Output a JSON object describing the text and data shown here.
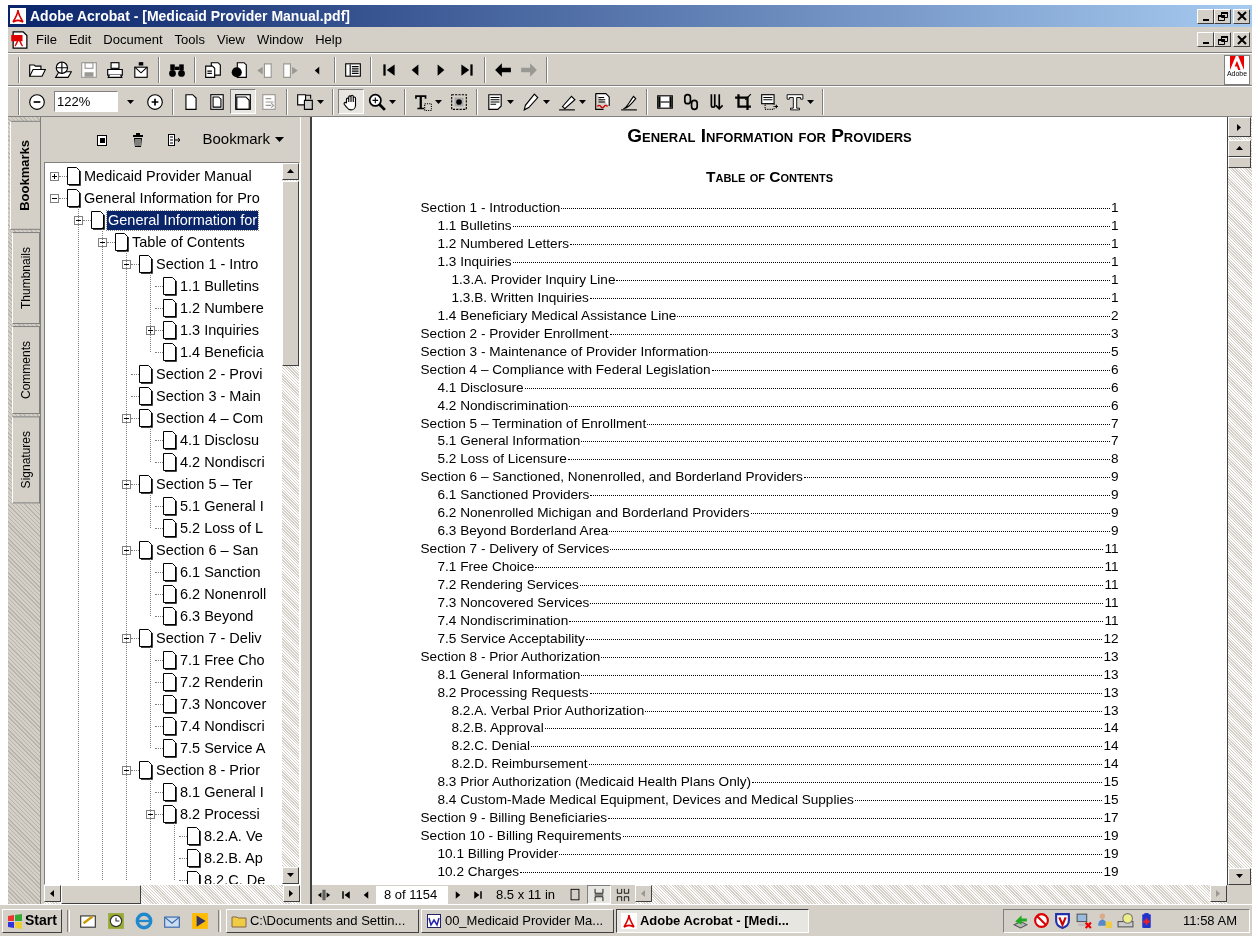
{
  "window": {
    "title": "Adobe Acrobat - [Medicaid Provider Manual.pdf]"
  },
  "menu": [
    "File",
    "Edit",
    "Document",
    "Tools",
    "View",
    "Window",
    "Help"
  ],
  "toolbar_1": [
    {
      "disabled": false
    },
    {
      "disabled": false
    },
    {
      "disabled": true
    },
    {
      "disabled": false
    },
    {
      "disabled": false
    },
    {
      "disabled": false
    },
    {
      "disabled": false
    },
    {
      "disabled": false
    },
    {
      "disabled": true
    },
    {
      "disabled": true
    },
    {
      "disabled": false
    },
    {
      "disabled": false
    },
    {
      "disabled": false
    },
    {
      "disabled": false
    },
    {
      "disabled": false
    },
    {
      "disabled": false
    },
    {
      "disabled": false
    },
    {
      "disabled": true
    }
  ],
  "brand": {
    "label": "Adobe"
  },
  "zoom": {
    "value": "122%"
  },
  "toolbar_2": [
    {
      "disabled": false,
      "selected": false
    },
    {
      "disabled": false,
      "selected": false
    },
    {
      "disabled": false,
      "selected": false
    },
    {
      "disabled": false,
      "selected": false
    },
    {
      "disabled": false,
      "selected": true
    },
    {
      "disabled": true,
      "selected": false
    },
    {
      "disabled": false,
      "selected": false
    },
    {
      "disabled": false,
      "selected": true
    },
    {
      "disabled": false,
      "selected": false
    },
    {
      "disabled": false,
      "selected": false
    },
    {
      "disabled": false,
      "selected": false
    },
    {
      "disabled": false,
      "selected": false
    },
    {
      "disabled": false,
      "selected": false
    },
    {
      "disabled": false,
      "selected": false
    },
    {
      "disabled": false,
      "selected": false
    },
    {
      "disabled": false,
      "selected": false
    },
    {
      "disabled": false,
      "selected": false
    },
    {
      "disabled": false,
      "selected": false
    },
    {
      "disabled": false,
      "selected": false
    },
    {
      "disabled": false,
      "selected": false
    },
    {
      "disabled": false,
      "selected": false
    },
    {
      "disabled": false,
      "selected": false
    }
  ],
  "panel_tabs": [
    {
      "label": "Bookmarks",
      "selected": true
    },
    {
      "label": "Thumbnails",
      "selected": false
    },
    {
      "label": "Comments",
      "selected": false
    },
    {
      "label": "Signatures",
      "selected": false
    }
  ],
  "bookmark_panel": {
    "menu_label": "Bookmark"
  },
  "bookmarks": [
    {
      "label": "Medicaid Provider Manual",
      "selected": false,
      "expanded": false
    },
    {
      "label": "General Information for Pro",
      "selected": false,
      "expanded": true,
      "children": [
        {
          "label": "General Information for",
          "selected": true,
          "expanded": true,
          "children": [
            {
              "label": "Table of Contents",
              "selected": false,
              "expanded": true,
              "children": [
                {
                  "label": "Section 1 - Intro",
                  "selected": false,
                  "expanded": true,
                  "children": [
                    {
                      "label": "1.1 Bulletins",
                      "selected": false
                    },
                    {
                      "label": "1.2 Numbere",
                      "selected": false
                    },
                    {
                      "label": "1.3 Inquiries",
                      "selected": false,
                      "expanded": false
                    },
                    {
                      "label": "1.4 Beneficia",
                      "selected": false
                    }
                  ]
                },
                {
                  "label": "Section 2 - Provi",
                  "selected": false
                },
                {
                  "label": "Section 3 - Main",
                  "selected": false
                },
                {
                  "label": "Section 4 – Com",
                  "selected": false,
                  "expanded": true,
                  "children": [
                    {
                      "label": "4.1 Disclosu",
                      "selected": false
                    },
                    {
                      "label": "4.2 Nondiscri",
                      "selected": false
                    }
                  ]
                },
                {
                  "label": "Section 5 – Ter",
                  "selected": false,
                  "expanded": true,
                  "children": [
                    {
                      "label": "5.1 General I",
                      "selected": false
                    },
                    {
                      "label": "5.2 Loss of L",
                      "selected": false
                    }
                  ]
                },
                {
                  "label": "Section 6 – San",
                  "selected": false,
                  "expanded": true,
                  "children": [
                    {
                      "label": "6.1 Sanction",
                      "selected": false
                    },
                    {
                      "label": "6.2 Nonenroll",
                      "selected": false
                    },
                    {
                      "label": "6.3 Beyond",
                      "selected": false
                    }
                  ]
                },
                {
                  "label": "Section 7 - Deliv",
                  "selected": false,
                  "expanded": true,
                  "children": [
                    {
                      "label": "7.1 Free Cho",
                      "selected": false
                    },
                    {
                      "label": "7.2 Renderin",
                      "selected": false
                    },
                    {
                      "label": "7.3 Noncover",
                      "selected": false
                    },
                    {
                      "label": "7.4 Nondiscri",
                      "selected": false
                    },
                    {
                      "label": "7.5 Service A",
                      "selected": false
                    }
                  ]
                },
                {
                  "label": "Section 8 - Prior",
                  "selected": false,
                  "expanded": true,
                  "children": [
                    {
                      "label": "8.1 General I",
                      "selected": false
                    },
                    {
                      "label": "8.2 Processi",
                      "selected": false,
                      "expanded": true,
                      "children": [
                        {
                          "label": "8.2.A. Ve",
                          "selected": false
                        },
                        {
                          "label": "8.2.B. Ap",
                          "selected": false
                        },
                        {
                          "label": "8.2.C. De",
                          "selected": false
                        }
                      ]
                    }
                  ]
                }
              ]
            }
          ]
        }
      ]
    }
  ],
  "document": {
    "title": "General Information for Providers",
    "subtitle": "Table of Contents",
    "toc": [
      {
        "title": "Section 1 - Introduction",
        "page": "1",
        "children": [
          {
            "title": "1.1 Bulletins",
            "page": "1"
          },
          {
            "title": "1.2 Numbered Letters",
            "page": "1"
          },
          {
            "title": "1.3 Inquiries",
            "page": "1",
            "children": [
              {
                "title": "1.3.A. Provider Inquiry Line",
                "page": "1"
              },
              {
                "title": "1.3.B. Written Inquiries",
                "page": "1"
              }
            ]
          },
          {
            "title": "1.4 Beneficiary Medical Assistance Line",
            "page": "2"
          }
        ]
      },
      {
        "title": "Section 2 - Provider Enrollment",
        "page": "3"
      },
      {
        "title": "Section 3 - Maintenance of Provider Information",
        "page": "5"
      },
      {
        "title": "Section 4 – Compliance with Federal Legislation",
        "page": "6",
        "children": [
          {
            "title": "4.1 Disclosure",
            "page": "6"
          },
          {
            "title": "4.2 Nondiscrimination",
            "page": "6"
          }
        ]
      },
      {
        "title": "Section 5 – Termination of Enrollment",
        "page": "7",
        "children": [
          {
            "title": "5.1 General Information",
            "page": "7"
          },
          {
            "title": "5.2 Loss of Licensure",
            "page": "8"
          }
        ]
      },
      {
        "title": "Section 6 – Sanctioned, Nonenrolled, and Borderland Providers",
        "page": "9",
        "children": [
          {
            "title": "6.1 Sanctioned Providers",
            "page": "9"
          },
          {
            "title": "6.2 Nonenrolled Michigan and Borderland Providers",
            "page": "9"
          },
          {
            "title": "6.3 Beyond Borderland Area",
            "page": "9"
          }
        ]
      },
      {
        "title": "Section 7 - Delivery of Services",
        "page": "11",
        "children": [
          {
            "title": "7.1 Free Choice",
            "page": "11"
          },
          {
            "title": "7.2 Rendering Services",
            "page": "11"
          },
          {
            "title": "7.3 Noncovered Services",
            "page": "11"
          },
          {
            "title": "7.4 Nondiscrimination",
            "page": "11"
          },
          {
            "title": "7.5 Service Acceptability",
            "page": "12"
          }
        ]
      },
      {
        "title": "Section 8 - Prior Authorization",
        "page": "13",
        "children": [
          {
            "title": "8.1 General Information",
            "page": "13"
          },
          {
            "title": "8.2 Processing Requests",
            "page": "13",
            "children": [
              {
                "title": "8.2.A. Verbal Prior Authorization",
                "page": "13"
              },
              {
                "title": "8.2.B. Approval",
                "page": "14"
              },
              {
                "title": "8.2.C. Denial",
                "page": "14"
              },
              {
                "title": "8.2.D. Reimbursement",
                "page": "14"
              }
            ]
          },
          {
            "title": "8.3 Prior Authorization (Medicaid Health Plans Only)",
            "page": "15"
          },
          {
            "title": "8.4 Custom-Made Medical Equipment, Devices and Medical Supplies",
            "page": "15"
          }
        ]
      },
      {
        "title": "Section 9 - Billing Beneficiaries",
        "page": "17"
      },
      {
        "title": "Section 10 - Billing Requirements",
        "page": "19",
        "children": [
          {
            "title": "10.1 Billing Provider",
            "page": "19"
          },
          {
            "title": "10.2 Charges",
            "page": "19"
          }
        ]
      }
    ]
  },
  "status_bar": {
    "page": "8 of 1154",
    "page_size": "8.5 x 11 in",
    "layout": [
      {
        "selected": false
      },
      {
        "selected": true
      },
      {
        "selected": false
      }
    ]
  },
  "taskbar": {
    "start": "Start",
    "tasks": [
      {
        "label": "C:\\Documents and Settin...",
        "selected": false
      },
      {
        "label": "00_Medicaid Provider Ma...",
        "selected": false
      },
      {
        "label": "Adobe Acrobat - [Medi...",
        "selected": true
      }
    ],
    "clock": "11:58 AM"
  }
}
